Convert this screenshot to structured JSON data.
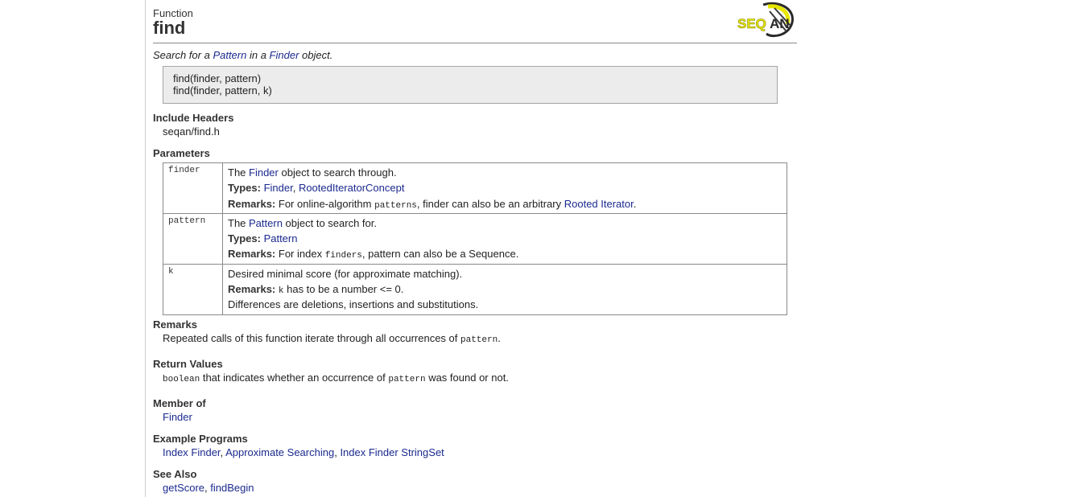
{
  "header": {
    "kind": "Function",
    "name": "find",
    "logo_text": "SEQAN"
  },
  "summary": {
    "before": "Search for a ",
    "link1": "Pattern",
    "middle": " in a ",
    "link2": "Finder",
    "after": " object."
  },
  "signatures": [
    "find(finder, pattern)",
    "find(finder, pattern, k)"
  ],
  "include_headers": {
    "title": "Include Headers",
    "value": "seqan/find.h"
  },
  "parameters": {
    "title": "Parameters",
    "finder": {
      "name": "finder",
      "desc_prefix": "The ",
      "desc_link": "Finder",
      "desc_suffix": " object to search through.",
      "types_label": "Types:",
      "type1": "Finder",
      "type_sep": ", ",
      "type2": "RootedIteratorConcept",
      "remarks_label": "Remarks:",
      "remarks_prefix": " For online-algorithm ",
      "remarks_code": "patterns",
      "remarks_middle": ", finder can also be an arbitrary ",
      "remarks_link": "Rooted Iterator",
      "remarks_suffix": "."
    },
    "pattern": {
      "name": "pattern",
      "desc_prefix": "The ",
      "desc_link": "Pattern",
      "desc_suffix": " object to search for.",
      "types_label": "Types:",
      "type1": "Pattern",
      "remarks_label": "Remarks:",
      "remarks_prefix": " For index ",
      "remarks_code": "finders",
      "remarks_suffix": ", pattern can also be a Sequence."
    },
    "k": {
      "name": "k",
      "desc": "Desired minimal score (for approximate matching).",
      "remarks_label": "Remarks:",
      "remarks_code": "k",
      "remarks_suffix": " has to be a number <= 0.",
      "extra": "Differences are deletions, insertions and substitutions."
    }
  },
  "remarks": {
    "title": "Remarks",
    "prefix": "Repeated calls of this function iterate through all occurrences of ",
    "code": "pattern",
    "suffix": "."
  },
  "return_values": {
    "title": "Return Values",
    "code1": "boolean",
    "middle": " that indicates whether an occurrence of ",
    "code2": "pattern",
    "suffix": " was found or not."
  },
  "member_of": {
    "title": "Member of",
    "link": "Finder"
  },
  "example_programs": {
    "title": "Example Programs",
    "links": [
      "Index Finder",
      "Approximate Searching",
      "Index Finder StringSet"
    ],
    "sep": ", "
  },
  "see_also": {
    "title": "See Also",
    "links": [
      "getScore",
      "findBegin"
    ],
    "sep": ", "
  }
}
